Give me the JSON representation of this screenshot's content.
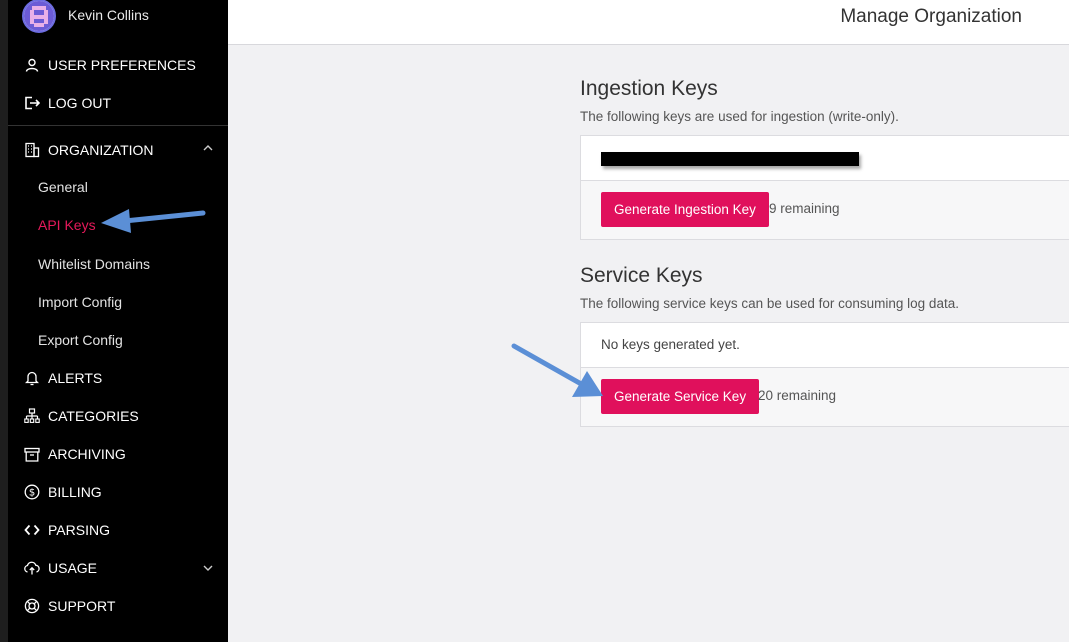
{
  "user": {
    "name": "Kevin Collins"
  },
  "nav": {
    "user_preferences": "USER PREFERENCES",
    "log_out": "LOG OUT",
    "organization": "ORGANIZATION",
    "org_sub": {
      "general": "General",
      "api_keys": "API Keys",
      "whitelist_domains": "Whitelist Domains",
      "import_config": "Import Config",
      "export_config": "Export Config"
    },
    "alerts": "ALERTS",
    "categories": "CATEGORIES",
    "archiving": "ARCHIVING",
    "billing": "BILLING",
    "parsing": "PARSING",
    "usage": "USAGE",
    "support": "SUPPORT"
  },
  "header": {
    "title": "Manage Organization"
  },
  "ingestion": {
    "title": "Ingestion Keys",
    "description": "The following keys are used for ingestion (write-only).",
    "button_label": "Generate Ingestion Key",
    "remaining": "9 remaining"
  },
  "service": {
    "title": "Service Keys",
    "description": "The following service keys can be used for consuming log data.",
    "empty_text": "No keys generated yet.",
    "button_label": "Generate Service Key",
    "remaining": "20 remaining"
  },
  "colors": {
    "accent": "#e0105c",
    "active_nav": "#e5195a",
    "sidebar_bg": "#000000",
    "annotation_arrow": "#5b8fd6"
  },
  "icons": {
    "user_preferences": "user-icon",
    "log_out": "logout-icon",
    "organization": "building-icon",
    "alerts": "bell-icon",
    "categories": "hierarchy-icon",
    "archiving": "archive-box-icon",
    "billing": "dollar-circle-icon",
    "parsing": "code-brackets-icon",
    "usage": "cloud-upload-icon",
    "support": "lifebuoy-icon"
  }
}
